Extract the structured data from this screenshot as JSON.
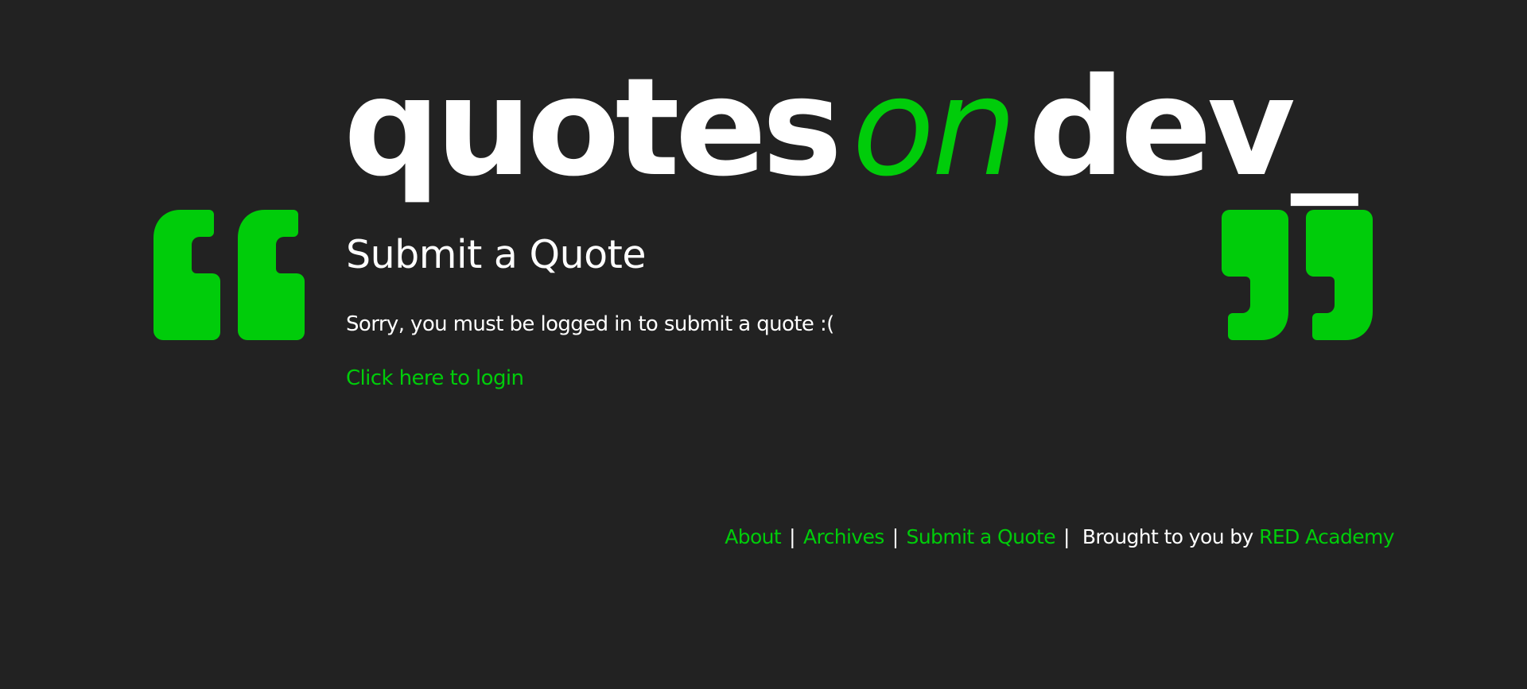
{
  "site": {
    "logo": {
      "word1": "quotes",
      "word2": "on",
      "word3": "dev_"
    }
  },
  "main": {
    "title": "Submit a Quote",
    "notice": "Sorry, you must be logged in to submit a quote :(",
    "login_link": "Click here to login"
  },
  "footer": {
    "nav": [
      {
        "label": "About"
      },
      {
        "label": "Archives"
      },
      {
        "label": "Submit a Quote"
      }
    ],
    "separator": "|",
    "credit_prefix": "Brought to you by",
    "credit_link": "RED Academy"
  },
  "icons": {
    "left_quote": "open-quote-icon",
    "right_quote": "close-quote-icon"
  },
  "colors": {
    "background": "#222222",
    "accent": "#00cc0a",
    "text": "#ffffff"
  }
}
